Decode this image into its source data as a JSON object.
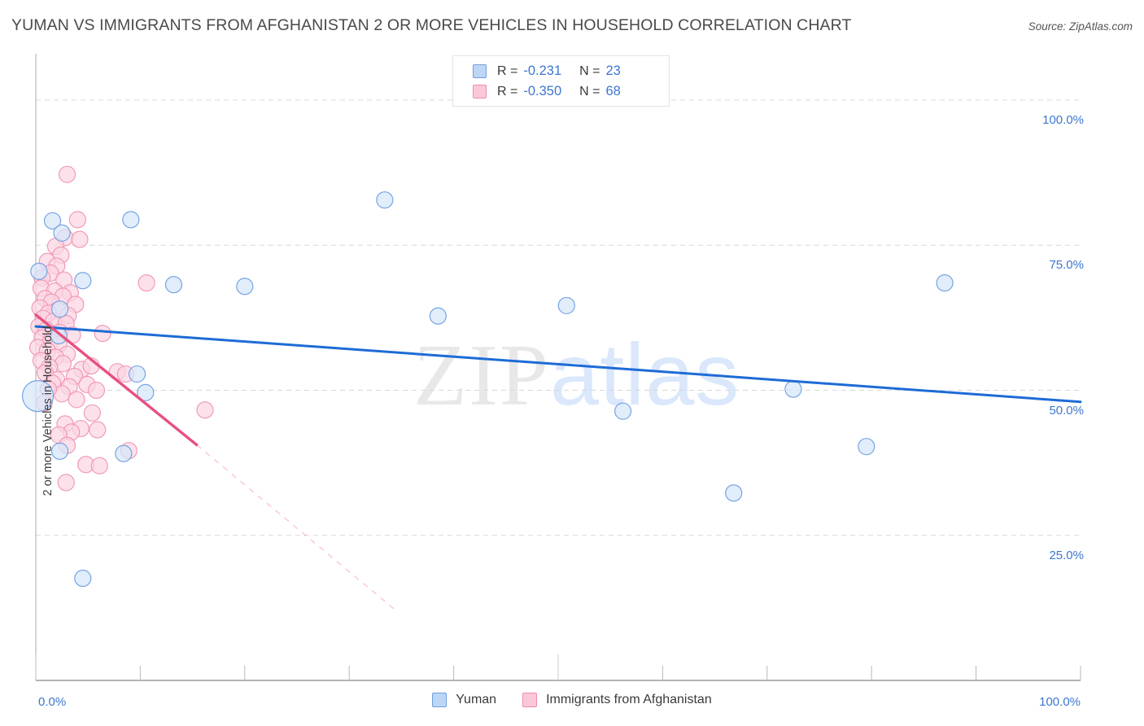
{
  "header": {
    "title": "YUMAN VS IMMIGRANTS FROM AFGHANISTAN 2 OR MORE VEHICLES IN HOUSEHOLD CORRELATION CHART",
    "source": "Source: ZipAtlas.com"
  },
  "watermark": {
    "part1": "ZIP",
    "part2": "atlas"
  },
  "correlation_legend": {
    "rows": [
      {
        "color": "#bed6f5",
        "r_label": "R =",
        "r_value": "-0.231",
        "n_label": "N =",
        "n_value": "23"
      },
      {
        "color": "#fbc8d8",
        "r_label": "R =",
        "r_value": "-0.350",
        "n_label": "N =",
        "n_value": "68"
      }
    ]
  },
  "series_legend": {
    "items": [
      {
        "label": "Yuman",
        "color": "#bed6f5",
        "border": "#6f9fe0"
      },
      {
        "label": "Immigrants from Afghanistan",
        "color": "#fbc8d8",
        "border": "#f08ab0"
      }
    ]
  },
  "chart_data": {
    "type": "scatter",
    "title": "YUMAN VS IMMIGRANTS FROM AFGHANISTAN 2 OR MORE VEHICLES IN HOUSEHOLD CORRELATION CHART",
    "xlabel": "",
    "ylabel": "2 or more Vehicles in Household",
    "xlim": [
      0,
      100
    ],
    "ylim": [
      0,
      108
    ],
    "grid": "horizontal-dashed",
    "legend_position": "bottom-center",
    "x_ticks": [
      0,
      10,
      20,
      30,
      40,
      50,
      60,
      70,
      80,
      90,
      100
    ],
    "x_tick_labels": [
      "0.0%",
      "",
      "",
      "",
      "",
      "",
      "",
      "",
      "",
      "",
      "100.0%"
    ],
    "y_ticks": [
      25,
      50,
      75,
      100
    ],
    "y_tick_labels": [
      "25.0%",
      "50.0%",
      "75.0%",
      "100.0%"
    ],
    "series": [
      {
        "name": "Yuman",
        "color": "#d6e6fa",
        "border": "#6f9fe0",
        "r": -0.231,
        "n": 23,
        "trendline": {
          "style": "solid",
          "color": "#1e6bd6",
          "x0": 0.0,
          "y0": 61.0,
          "x1": 100.0,
          "y1": 48.0
        },
        "points": [
          {
            "x": 0.3,
            "y": 70.5,
            "r": 10
          },
          {
            "x": 1.6,
            "y": 79.2,
            "r": 10
          },
          {
            "x": 2.5,
            "y": 77.1,
            "r": 10
          },
          {
            "x": 4.5,
            "y": 68.9,
            "r": 10
          },
          {
            "x": 9.1,
            "y": 79.4,
            "r": 10
          },
          {
            "x": 13.2,
            "y": 68.2,
            "r": 10
          },
          {
            "x": 20.0,
            "y": 67.9,
            "r": 10
          },
          {
            "x": 33.4,
            "y": 82.8,
            "r": 10
          },
          {
            "x": 2.3,
            "y": 64.0,
            "r": 10
          },
          {
            "x": 2.2,
            "y": 59.4,
            "r": 10
          },
          {
            "x": 38.5,
            "y": 62.8,
            "r": 10
          },
          {
            "x": 50.8,
            "y": 64.6,
            "r": 10
          },
          {
            "x": 87.0,
            "y": 68.5,
            "r": 10
          },
          {
            "x": 0.2,
            "y": 49.0,
            "r": 19
          },
          {
            "x": 9.7,
            "y": 52.8,
            "r": 10
          },
          {
            "x": 10.5,
            "y": 49.6,
            "r": 10
          },
          {
            "x": 72.5,
            "y": 50.2,
            "r": 10
          },
          {
            "x": 56.2,
            "y": 46.4,
            "r": 10
          },
          {
            "x": 79.5,
            "y": 40.3,
            "r": 10
          },
          {
            "x": 2.3,
            "y": 39.5,
            "r": 10
          },
          {
            "x": 8.4,
            "y": 39.1,
            "r": 10
          },
          {
            "x": 66.8,
            "y": 32.3,
            "r": 10
          },
          {
            "x": 4.5,
            "y": 17.6,
            "r": 10
          }
        ]
      },
      {
        "name": "Immigrants from Afghanistan",
        "color": "#fbd6e2",
        "border": "#f195b5",
        "r": -0.35,
        "n": 68,
        "trendline": {
          "style": "solid-then-dashed",
          "color": "#e8507f",
          "x0": 0.0,
          "y0": 63.0,
          "x1": 15.4,
          "y1": 40.6,
          "dash_x1": 34.5,
          "dash_y1": 12.0
        },
        "points": [
          {
            "x": 3.0,
            "y": 87.2,
            "r": 10
          },
          {
            "x": 4.0,
            "y": 79.4,
            "r": 10
          },
          {
            "x": 2.8,
            "y": 76.3,
            "r": 10
          },
          {
            "x": 4.2,
            "y": 76.0,
            "r": 10
          },
          {
            "x": 1.9,
            "y": 74.8,
            "r": 10
          },
          {
            "x": 2.4,
            "y": 73.3,
            "r": 10
          },
          {
            "x": 1.1,
            "y": 72.2,
            "r": 10
          },
          {
            "x": 2.0,
            "y": 71.4,
            "r": 10
          },
          {
            "x": 1.4,
            "y": 70.2,
            "r": 10
          },
          {
            "x": 0.6,
            "y": 69.4,
            "r": 10
          },
          {
            "x": 2.7,
            "y": 69.0,
            "r": 10
          },
          {
            "x": 10.6,
            "y": 68.5,
            "r": 10
          },
          {
            "x": 0.5,
            "y": 67.6,
            "r": 10
          },
          {
            "x": 1.8,
            "y": 67.1,
            "r": 10
          },
          {
            "x": 3.3,
            "y": 66.8,
            "r": 10
          },
          {
            "x": 2.6,
            "y": 66.2,
            "r": 10
          },
          {
            "x": 0.9,
            "y": 65.8,
            "r": 10
          },
          {
            "x": 1.5,
            "y": 65.2,
            "r": 10
          },
          {
            "x": 3.8,
            "y": 64.8,
            "r": 10
          },
          {
            "x": 0.4,
            "y": 64.2,
            "r": 10
          },
          {
            "x": 2.1,
            "y": 63.8,
            "r": 10
          },
          {
            "x": 1.2,
            "y": 63.3,
            "r": 10
          },
          {
            "x": 3.1,
            "y": 62.9,
            "r": 10
          },
          {
            "x": 0.7,
            "y": 62.4,
            "r": 10
          },
          {
            "x": 1.7,
            "y": 61.9,
            "r": 10
          },
          {
            "x": 2.9,
            "y": 61.5,
            "r": 10
          },
          {
            "x": 0.3,
            "y": 61.0,
            "r": 10
          },
          {
            "x": 1.0,
            "y": 60.4,
            "r": 10
          },
          {
            "x": 2.3,
            "y": 60.0,
            "r": 10
          },
          {
            "x": 3.5,
            "y": 59.5,
            "r": 10
          },
          {
            "x": 0.6,
            "y": 59.0,
            "r": 10
          },
          {
            "x": 1.4,
            "y": 58.4,
            "r": 10
          },
          {
            "x": 2.2,
            "y": 57.9,
            "r": 10
          },
          {
            "x": 0.2,
            "y": 57.4,
            "r": 10
          },
          {
            "x": 1.1,
            "y": 56.8,
            "r": 10
          },
          {
            "x": 3.0,
            "y": 56.2,
            "r": 10
          },
          {
            "x": 1.9,
            "y": 55.7,
            "r": 10
          },
          {
            "x": 0.5,
            "y": 55.1,
            "r": 10
          },
          {
            "x": 2.6,
            "y": 54.6,
            "r": 10
          },
          {
            "x": 1.3,
            "y": 54.0,
            "r": 10
          },
          {
            "x": 4.4,
            "y": 53.6,
            "r": 10
          },
          {
            "x": 0.9,
            "y": 53.0,
            "r": 10
          },
          {
            "x": 3.7,
            "y": 52.4,
            "r": 10
          },
          {
            "x": 2.0,
            "y": 51.8,
            "r": 10
          },
          {
            "x": 1.6,
            "y": 51.2,
            "r": 10
          },
          {
            "x": 5.3,
            "y": 54.2,
            "r": 10
          },
          {
            "x": 4.9,
            "y": 51.0,
            "r": 10
          },
          {
            "x": 7.8,
            "y": 53.2,
            "r": 10
          },
          {
            "x": 8.6,
            "y": 52.8,
            "r": 10
          },
          {
            "x": 3.2,
            "y": 50.6,
            "r": 10
          },
          {
            "x": 5.8,
            "y": 50.0,
            "r": 10
          },
          {
            "x": 2.5,
            "y": 49.4,
            "r": 10
          },
          {
            "x": 3.9,
            "y": 48.4,
            "r": 10
          },
          {
            "x": 16.2,
            "y": 46.6,
            "r": 10
          },
          {
            "x": 5.4,
            "y": 46.1,
            "r": 10
          },
          {
            "x": 2.8,
            "y": 44.2,
            "r": 10
          },
          {
            "x": 4.3,
            "y": 43.4,
            "r": 10
          },
          {
            "x": 5.9,
            "y": 43.2,
            "r": 10
          },
          {
            "x": 3.4,
            "y": 42.8,
            "r": 10
          },
          {
            "x": 2.2,
            "y": 42.3,
            "r": 10
          },
          {
            "x": 3.0,
            "y": 40.5,
            "r": 10
          },
          {
            "x": 8.9,
            "y": 39.6,
            "r": 10
          },
          {
            "x": 4.8,
            "y": 37.2,
            "r": 10
          },
          {
            "x": 6.1,
            "y": 37.0,
            "r": 10
          },
          {
            "x": 2.9,
            "y": 34.1,
            "r": 10
          },
          {
            "x": 1.2,
            "y": 50.2,
            "r": 10
          },
          {
            "x": 0.8,
            "y": 47.8,
            "r": 10
          },
          {
            "x": 6.4,
            "y": 59.8,
            "r": 10
          }
        ]
      }
    ]
  }
}
